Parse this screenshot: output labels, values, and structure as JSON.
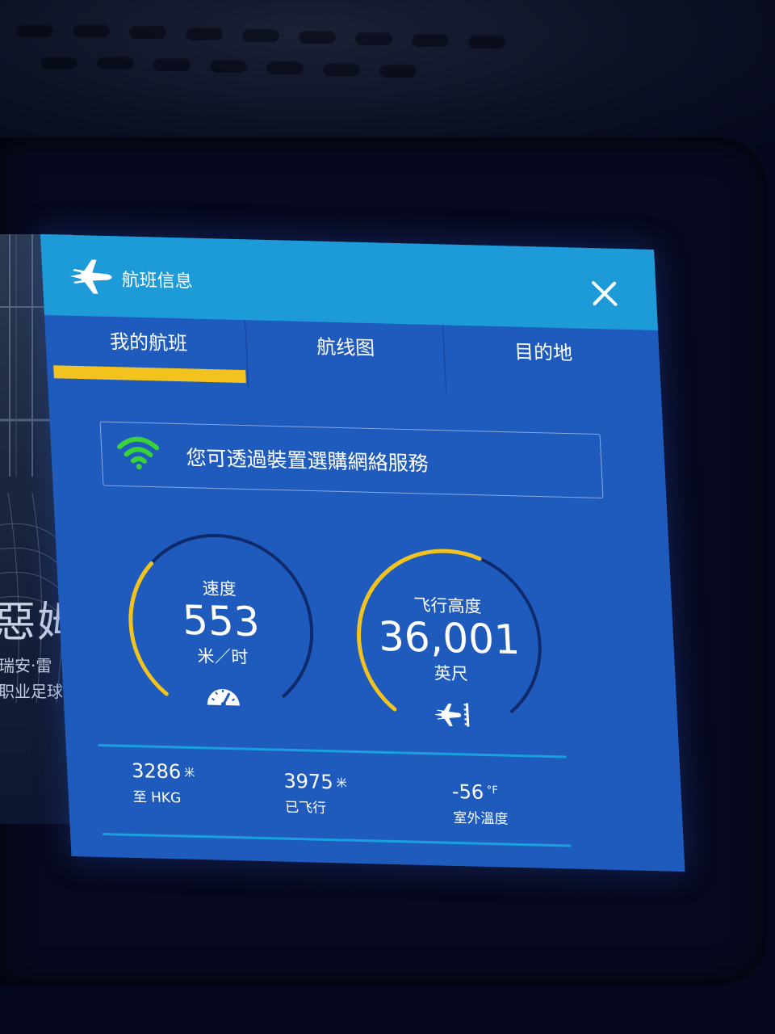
{
  "background": {
    "title": "惡姆",
    "subtitle_1": "瑞安·雷",
    "subtitle_2": "职业足球"
  },
  "panel": {
    "title": "航班信息",
    "header_icon": "airplane-icon",
    "close_icon": "close-icon"
  },
  "tabs": [
    {
      "label": "我的航班",
      "active": true
    },
    {
      "label": "航线图",
      "active": false
    },
    {
      "label": "目的地",
      "active": false
    }
  ],
  "wifi": {
    "icon": "wifi-icon",
    "message": "您可透過裝置選購網絡服務"
  },
  "gauges": {
    "speed": {
      "title": "速度",
      "value": "553",
      "unit": "米／时",
      "icon": "speedometer-icon",
      "fill_fraction": 0.33
    },
    "altitude": {
      "title": "飞行高度",
      "value": "36,001",
      "unit": "英尺",
      "icon": "altitude-plane-icon",
      "fill_fraction": 0.58
    }
  },
  "stats": {
    "to_destination": {
      "value": "3286",
      "unit": "米",
      "label": "至 HKG"
    },
    "flown": {
      "value": "3975",
      "unit": "米",
      "label": "已飞行"
    },
    "outside_temp": {
      "value": "-56",
      "unit": "°F",
      "label": "室外溫度"
    }
  },
  "colors": {
    "panel": "#1e5bbd",
    "header": "#1d9ad8",
    "accent": "#f2c21f",
    "wifi": "#3ad13a",
    "gauge_track": "#0f2a6b",
    "separator": "#1aa0e0"
  }
}
